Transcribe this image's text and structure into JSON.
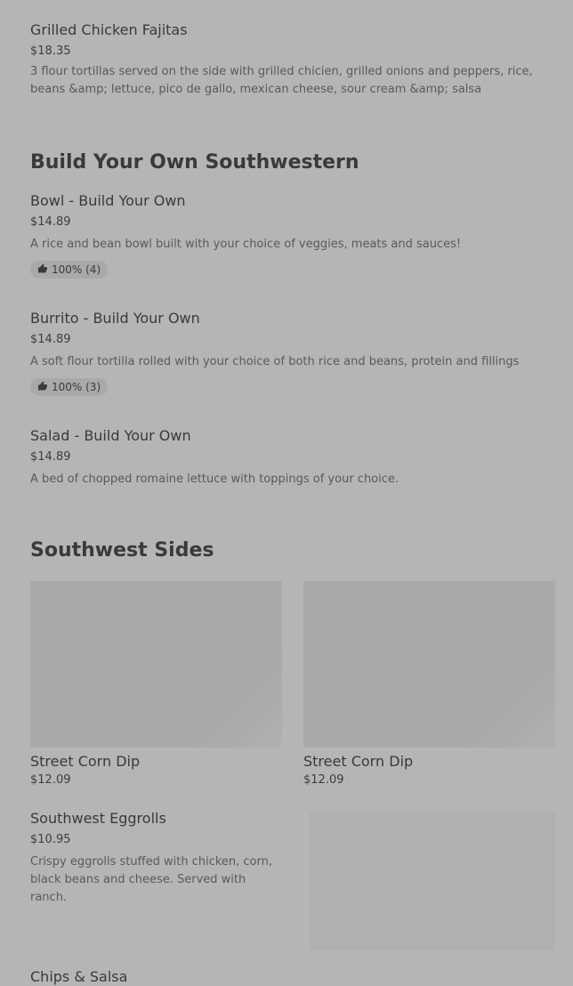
{
  "fajitas": {
    "name": "Grilled Chicken Fajitas",
    "price": "$18.35",
    "desc": "3 flour tortillas served on the side with grilled chicien, grilled onions and peppers, rice, beans &amp; lettuce, pico de gallo, mexican cheese, sour cream &amp; salsa"
  },
  "section_build": {
    "title": "Build Your Own Southwestern"
  },
  "bowl": {
    "name": "Bowl - Build Your Own",
    "price": "$14.89",
    "desc": "A rice and bean bowl built with your choice of veggies, meats and sauces!",
    "rating": "100% (4)"
  },
  "burrito": {
    "name": "Burrito - Build Your Own",
    "price": "$14.89",
    "desc": "A soft flour tortilla rolled with your choice of both rice and beans, protein and fillings",
    "rating": "100% (3)"
  },
  "salad": {
    "name": "Salad - Build Your Own",
    "price": "$14.89",
    "desc": "A bed of chopped romaine lettuce with toppings of your choice."
  },
  "section_sides": {
    "title": "Southwest Sides"
  },
  "cards": [
    {
      "name": "Street Corn Dip",
      "price": "$12.09"
    },
    {
      "name": "Street Corn Dip",
      "price": "$12.09"
    }
  ],
  "eggrolls": {
    "name": "Southwest Eggrolls",
    "price": "$10.95",
    "desc": "Crispy eggrolls stuffed with chicken, corn, black beans and cheese. Served with ranch."
  },
  "chips": {
    "name": "Chips & Salsa"
  },
  "icons": {
    "rating": "thumbs-up-icon"
  }
}
